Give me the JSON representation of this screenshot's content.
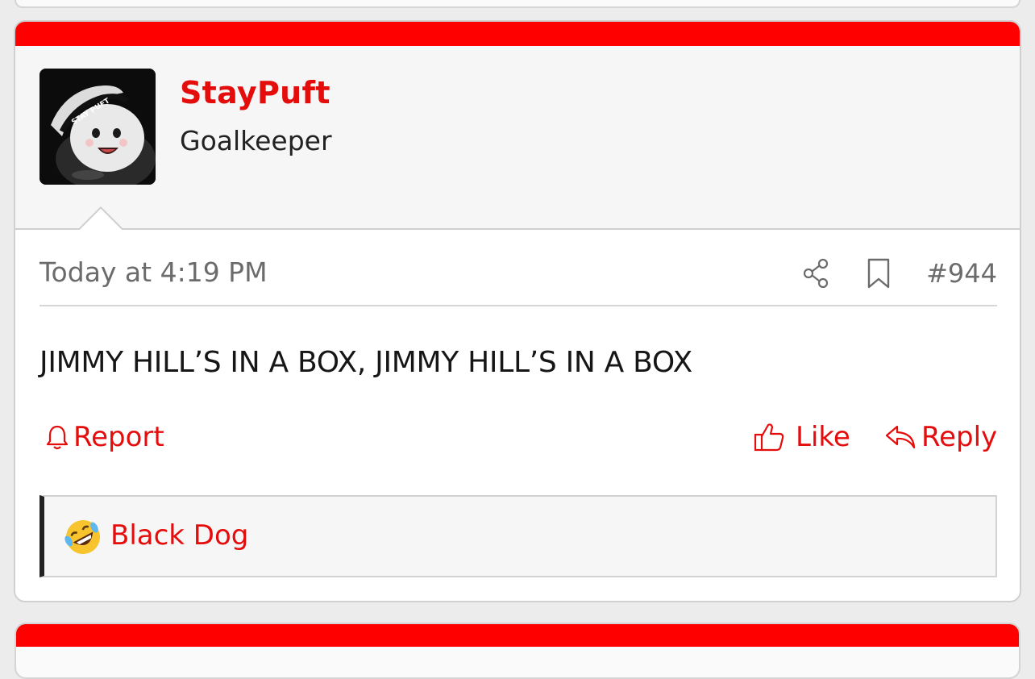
{
  "post": {
    "author": "StayPuft",
    "user_title": "Goalkeeper",
    "date": "Today at 4:19 PM",
    "number": "#944",
    "message": "JIMMY HILL’S IN A BOX, JIMMY HILL’S IN A BOX",
    "avatar": {
      "caption": "STAY PUFT"
    },
    "actions": {
      "report": "Report",
      "like": "Like",
      "reply": "Reply"
    },
    "reactions": {
      "emoji": "rolling-on-floor-laughing",
      "names": "Black Dog"
    }
  },
  "theme": {
    "accent": "#fe0000",
    "link": "#e50c0c",
    "muted": "#6b6b6b"
  },
  "icons": {
    "share": "share-icon",
    "bookmark": "bookmark-icon",
    "report": "bell-icon",
    "like": "thumbs-up-icon",
    "reply": "reply-arrow-icon"
  }
}
